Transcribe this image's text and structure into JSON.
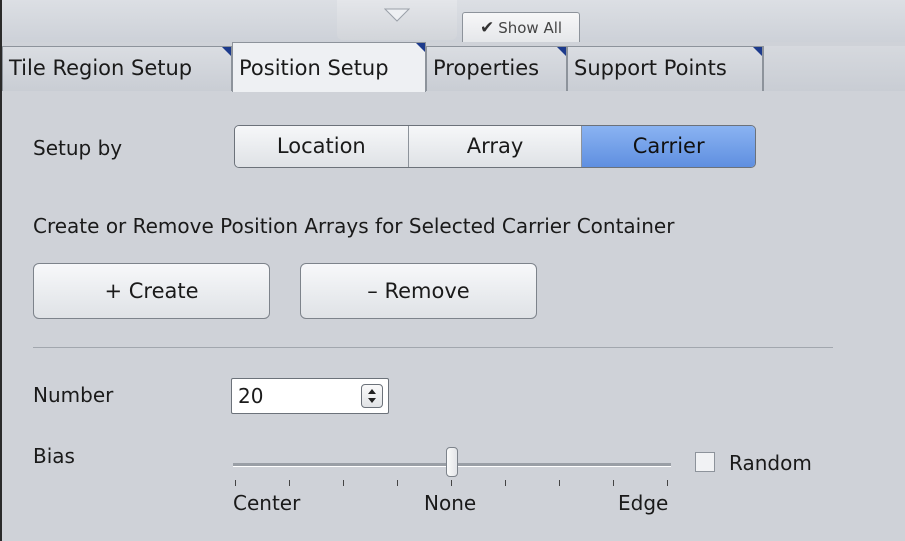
{
  "header": {
    "show_all_label": "Show All"
  },
  "tabs": [
    {
      "label": "Tile Region Setup",
      "active": false
    },
    {
      "label": "Position Setup",
      "active": true
    },
    {
      "label": "Properties",
      "active": false
    },
    {
      "label": "Support Points",
      "active": false
    }
  ],
  "setup": {
    "label": "Setup by",
    "options": [
      "Location",
      "Array",
      "Carrier"
    ],
    "selected": "Carrier"
  },
  "arrays": {
    "description": "Create or Remove Position Arrays for Selected Carrier Container",
    "create_label": "+ Create",
    "remove_label": "– Remove"
  },
  "number": {
    "label": "Number",
    "value": "20"
  },
  "bias": {
    "label": "Bias",
    "position_fraction": 0.5,
    "tick_labels": [
      "Center",
      "None",
      "Edge"
    ],
    "random_label": "Random",
    "random_checked": false
  },
  "colors": {
    "selected_segment": "#6f9ae6",
    "tab_corner": "#1c3a8c",
    "panel_bg": "#cfd2d8"
  }
}
